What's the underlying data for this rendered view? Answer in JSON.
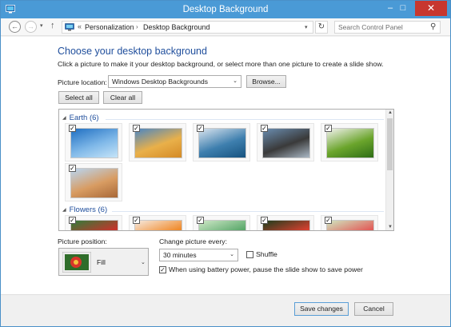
{
  "window": {
    "title": "Desktop Background",
    "controls": {
      "minimize": "–",
      "maximize": "□",
      "close": "✕"
    }
  },
  "nav": {
    "back": "←",
    "forward": "→",
    "dropdown": "▾",
    "up": "↑",
    "address_prefix": "«",
    "breadcrumbs": [
      "Personalization",
      "Desktop Background"
    ],
    "separator": "›",
    "address_dropdown": "▾",
    "refresh": "↻",
    "search_placeholder": "Search Control Panel",
    "search_icon": "⚲"
  },
  "main": {
    "heading": "Choose your desktop background",
    "subtext": "Click a picture to make it your desktop background, or select more than one picture to create a slide show.",
    "picture_location_label": "Picture location:",
    "picture_location_value": "Windows Desktop Backgrounds",
    "browse_label": "Browse...",
    "select_all_label": "Select all",
    "clear_all_label": "Clear all"
  },
  "gallery": {
    "groups": [
      {
        "name": "Earth (6)",
        "thumbnails": [
          {
            "name": "ice-cave",
            "checked": true,
            "colors": [
              "#1f6fc2",
              "#7fb8e8",
              "#c6e4f8"
            ]
          },
          {
            "name": "sand-dune-field",
            "checked": true,
            "colors": [
              "#4a86c4",
              "#e9b04a",
              "#d48a26"
            ]
          },
          {
            "name": "ocean-waves",
            "checked": true,
            "colors": [
              "#d9e4ee",
              "#3e7fae",
              "#16527f"
            ]
          },
          {
            "name": "rock-coast",
            "checked": true,
            "colors": [
              "#6a8db0",
              "#3a3a3a",
              "#a9b7c4"
            ]
          },
          {
            "name": "green-hills",
            "checked": true,
            "colors": [
              "#f2f2ee",
              "#6ba52c",
              "#2e6d16"
            ]
          },
          {
            "name": "desert-dunes",
            "checked": true,
            "colors": [
              "#b8d6f2",
              "#d89c62",
              "#a86838"
            ]
          }
        ]
      },
      {
        "name": "Flowers (6)",
        "thumbnails": [
          {
            "name": "red-flower",
            "checked": true,
            "colors": [
              "#2f7d3a",
              "#c8332b",
              "#f1c44b"
            ]
          },
          {
            "name": "orange-flower",
            "checked": true,
            "colors": [
              "#f6e9de",
              "#f08a2a",
              "#f6c65a"
            ]
          },
          {
            "name": "green-leaf",
            "checked": true,
            "colors": [
              "#cfe8c7",
              "#5aa86b",
              "#a7d3a0"
            ]
          },
          {
            "name": "red-petals",
            "checked": true,
            "colors": [
              "#1b3d1b",
              "#d84030",
              "#f0b33a"
            ]
          },
          {
            "name": "pink-bloom",
            "checked": true,
            "colors": [
              "#cfe6c0",
              "#e25b58",
              "#8bc47a"
            ]
          }
        ]
      }
    ],
    "scroll": {
      "up": "▲",
      "down": "▼"
    }
  },
  "settings": {
    "picture_position_label": "Picture position:",
    "picture_position_value": "Fill",
    "change_every_label": "Change picture every:",
    "change_every_value": "30 minutes",
    "shuffle_label": "Shuffle",
    "shuffle_checked": false,
    "battery_label": "When using battery power, pause the slide show to save power",
    "battery_checked": true
  },
  "footer": {
    "save_label": "Save changes",
    "cancel_label": "Cancel"
  },
  "icons": {
    "dropdown": "⌄",
    "check": "✓",
    "tri": "◢"
  },
  "colors": {
    "titlebar": "#4a9ad6",
    "heading": "#1f4e9c",
    "close": "#c7372f"
  }
}
